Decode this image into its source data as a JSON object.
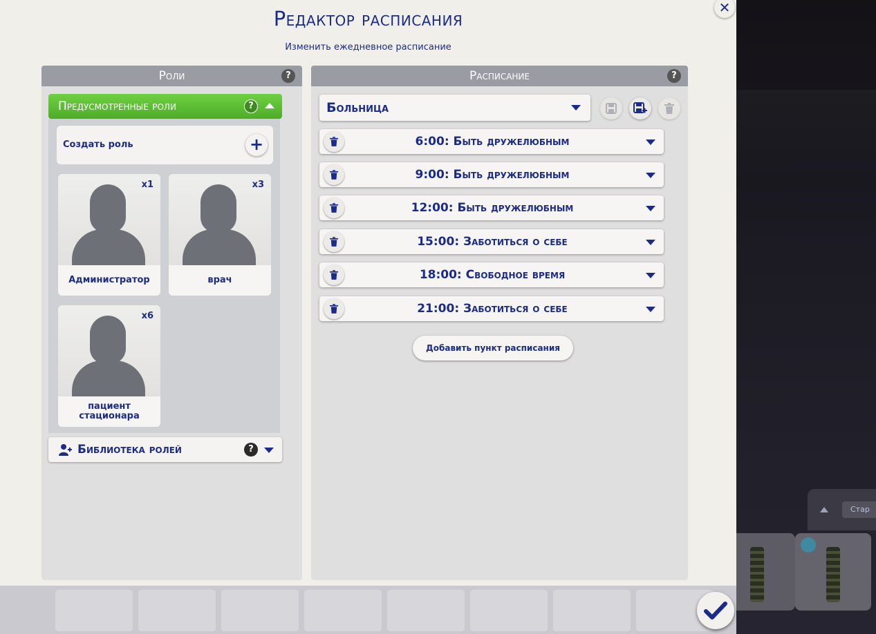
{
  "dialog": {
    "title": "Редактор расписания",
    "subtitle": "Изменить ежедневное расписание",
    "close_icon": "close-icon",
    "confirm_icon": "checkmark-icon"
  },
  "roles_panel": {
    "header": "Роли",
    "help": "?",
    "predefined": {
      "header": "Предусмотренные роли",
      "help": "?",
      "create_label": "Создать роль",
      "create_icon": "plus-icon",
      "roles": [
        {
          "name": "Администратор",
          "count": "x1"
        },
        {
          "name": "врач",
          "count": "x3"
        },
        {
          "name": "пациент стационара",
          "count": "x6"
        }
      ]
    },
    "library": {
      "header": "Библиотека ролей",
      "help": "?",
      "icon": "person-add-icon"
    }
  },
  "schedule_panel": {
    "header": "Расписание",
    "help": "?",
    "selected_schedule": "Больница",
    "items": [
      {
        "label": "6:00: Быть дружелюбным"
      },
      {
        "label": "9:00: Быть дружелюбным"
      },
      {
        "label": "12:00: Быть дружелюбным"
      },
      {
        "label": "15:00: Заботиться о себе"
      },
      {
        "label": "18:00: Свободное время"
      },
      {
        "label": "21:00: Заботиться о себе"
      }
    ],
    "add_item_label": "Добавить пункт расписания"
  },
  "background": {
    "tray_chip": "Стар"
  },
  "colors": {
    "accent_blue": "#1b2b8a",
    "green_header": "#5cbf33",
    "panel_header": "#9a9ca3",
    "dialog_bg": "#f1efea"
  }
}
